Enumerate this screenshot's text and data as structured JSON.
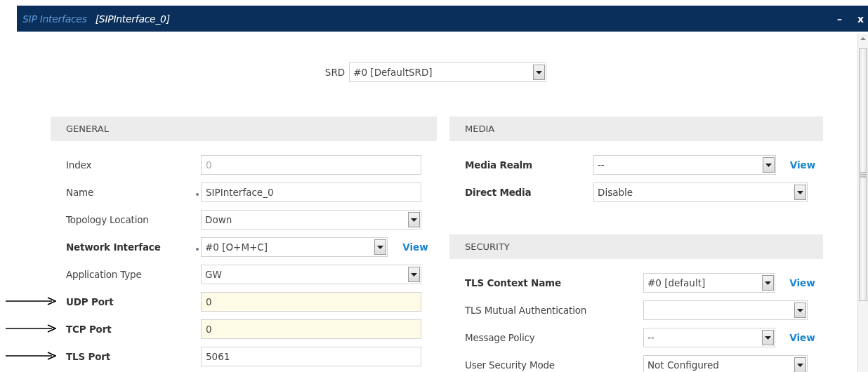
{
  "window": {
    "title": "SIP Interfaces",
    "subtitle": "[SIPInterface_0]",
    "minimize": "–",
    "close": "x"
  },
  "srd": {
    "label": "SRD",
    "value": "#0 [DefaultSRD]"
  },
  "sections": [
    {
      "title": "GENERAL",
      "rows": [
        {
          "label": "Index",
          "kind": "input",
          "value": "0",
          "bold": false,
          "required": false,
          "disabled": true,
          "highlighted": false,
          "annotated": false
        },
        {
          "label": "Name",
          "kind": "input",
          "value": "SIPInterface_0",
          "bold": false,
          "required": true,
          "disabled": false,
          "highlighted": false,
          "annotated": false
        },
        {
          "label": "Topology Location",
          "kind": "select",
          "value": "Down",
          "bold": false,
          "required": false,
          "disabled": false,
          "highlighted": false,
          "annotated": false
        },
        {
          "label": "Network Interface",
          "kind": "select",
          "value": "#0 [O+M+C]",
          "bold": true,
          "required": true,
          "disabled": false,
          "highlighted": false,
          "annotated": false,
          "link": "View"
        },
        {
          "label": "Application Type",
          "kind": "select",
          "value": "GW",
          "bold": false,
          "required": false,
          "disabled": false,
          "highlighted": false,
          "annotated": false
        },
        {
          "label": "UDP Port",
          "kind": "input",
          "value": "0",
          "bold": true,
          "required": false,
          "disabled": false,
          "highlighted": true,
          "annotated": true
        },
        {
          "label": "TCP Port",
          "kind": "input",
          "value": "0",
          "bold": true,
          "required": false,
          "disabled": false,
          "highlighted": true,
          "annotated": true
        },
        {
          "label": "TLS Port",
          "kind": "input",
          "value": "5061",
          "bold": true,
          "required": false,
          "disabled": false,
          "highlighted": false,
          "annotated": true
        }
      ]
    },
    {
      "title": "MEDIA",
      "rows": [
        {
          "label": "Media Realm",
          "kind": "select",
          "value": "--",
          "bold": true,
          "required": false,
          "disabled": false,
          "highlighted": false,
          "annotated": false,
          "link": "View"
        },
        {
          "label": "Direct Media",
          "kind": "select",
          "value": "Disable",
          "bold": true,
          "required": false,
          "disabled": false,
          "highlighted": false,
          "annotated": false
        }
      ]
    },
    {
      "title": "SECURITY",
      "rows": [
        {
          "label": "TLS Context Name",
          "kind": "select",
          "value": "#0 [default]",
          "bold": true,
          "required": false,
          "disabled": false,
          "highlighted": false,
          "annotated": false,
          "link": "View"
        },
        {
          "label": "TLS Mutual Authentication",
          "kind": "select",
          "bold": false,
          "required": false,
          "disabled": false,
          "highlighted": false,
          "annotated": false
        },
        {
          "label": "Message Policy",
          "kind": "select",
          "value": "--",
          "bold": false,
          "required": false,
          "disabled": false,
          "highlighted": false,
          "annotated": false,
          "link": "View"
        },
        {
          "label": "User Security Mode",
          "kind": "select",
          "value": "Not Configured",
          "bold": false,
          "required": false,
          "disabled": false,
          "highlighted": false,
          "annotated": false
        }
      ]
    }
  ]
}
